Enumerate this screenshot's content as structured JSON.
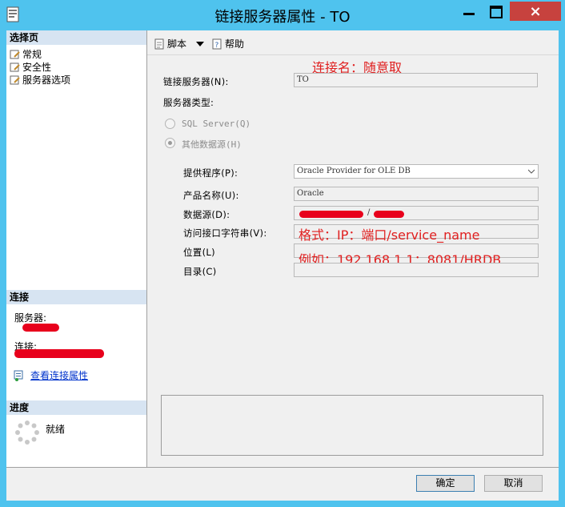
{
  "window": {
    "title": "链接服务器属性 - TO",
    "controls": {
      "minimize": "minimize",
      "maximize": "maximize",
      "close": "×"
    }
  },
  "sidebar": {
    "select_page_header": "选择页",
    "pages": [
      {
        "label": "常规",
        "icon": "page-wrench-icon"
      },
      {
        "label": "安全性",
        "icon": "page-wrench-icon"
      },
      {
        "label": "服务器选项",
        "icon": "page-wrench-icon"
      }
    ],
    "connection_header": "连接",
    "server_label": "服务器:",
    "connection_label": "连接:",
    "view_connection_link": "查看连接属性",
    "progress_header": "进度",
    "progress_status": "就绪"
  },
  "toolbar": {
    "script_label": "脚本",
    "help_label": "帮助"
  },
  "form": {
    "linked_server_label": "链接服务器(N):",
    "linked_server_value": "TO",
    "server_type_label": "服务器类型:",
    "sql_server_option": "SQL Server(Q)",
    "other_source_option": "其他数据源(H)",
    "provider_label": "提供程序(P):",
    "provider_value": "Oracle Provider for OLE DB",
    "product_name_label": "产品名称(U):",
    "product_name_value": "Oracle",
    "data_source_label": "数据源(D):",
    "data_source_separator": "/",
    "provider_string_label": "访问接口字符串(V):",
    "location_label": "位置(L)",
    "catalog_label": "目录(C)"
  },
  "annotations": {
    "name_note": "连接名：随意取",
    "format_note": "格式：IP：端口/service_name",
    "example_note": "例如：192.168.1.1：8081/HRDB"
  },
  "buttons": {
    "ok": "确定",
    "cancel": "取消"
  },
  "colors": {
    "titlebar": "#4fc3ee",
    "close_button": "#c7423e",
    "annotation": "#e02020",
    "redaction": "#e8001c",
    "section_header": "#d7e4f2"
  }
}
